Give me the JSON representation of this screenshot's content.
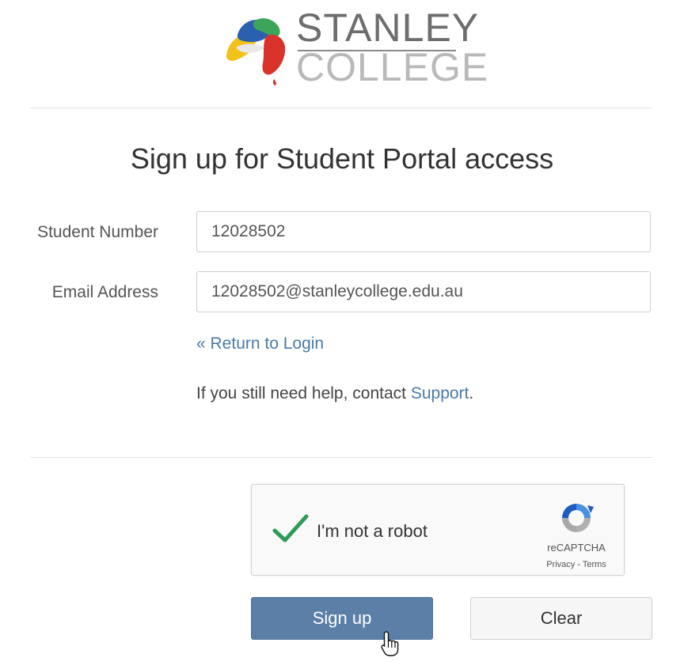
{
  "brand": {
    "name_top": "STANLEY",
    "name_bottom": "COLLEGE"
  },
  "page": {
    "title": "Sign up for Student Portal access"
  },
  "form": {
    "student_number_label": "Student Number",
    "student_number_value": "12028502",
    "email_label": "Email Address",
    "email_value": "12028502@stanleycollege.edu.au",
    "return_link": "« Return to Login",
    "help_text": "If you still need help, contact ",
    "support_link": "Support",
    "help_period": "."
  },
  "captcha": {
    "label": "I'm not a robot",
    "brand": "reCAPTCHA",
    "privacy": "Privacy",
    "separator": " - ",
    "terms": "Terms",
    "checked": true
  },
  "buttons": {
    "signup": "Sign up",
    "clear": "Clear"
  },
  "colors": {
    "primary": "#5b7fa6",
    "link": "#4a7aa8",
    "check": "#2e9a57"
  }
}
